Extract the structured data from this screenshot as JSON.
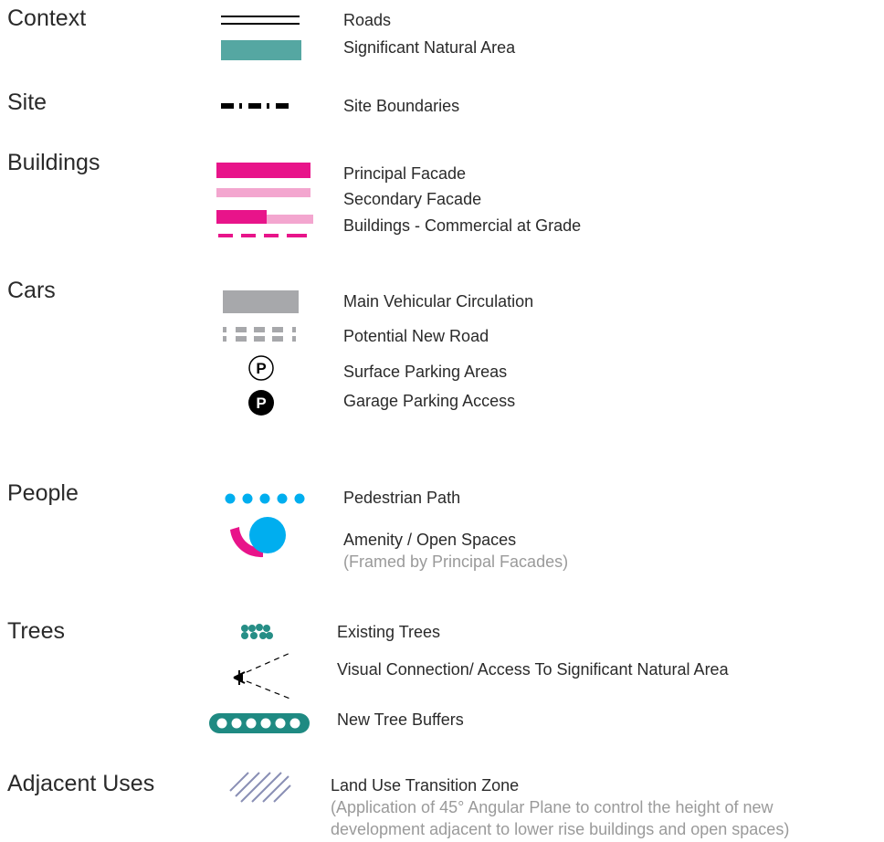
{
  "colors": {
    "teal": "#55a7a2",
    "magenta": "#e8148a",
    "pink_light": "#f3a6cf",
    "gray": "#a7a8ab",
    "cyan": "#00aeef",
    "hatch": "#8a8fb5",
    "black": "#000000"
  },
  "sections": {
    "context": {
      "title": "Context",
      "items": [
        {
          "label": "Roads",
          "icon": "double-line-icon"
        },
        {
          "label": "Significant Natural Area",
          "icon": "teal-block-icon"
        }
      ]
    },
    "site": {
      "title": "Site",
      "items": [
        {
          "label": "Site Boundaries",
          "icon": "dash-dot-line-icon"
        }
      ]
    },
    "buildings": {
      "title": "Buildings",
      "items": [
        {
          "label": "Principal Facade",
          "icon": "magenta-bar-icon"
        },
        {
          "label": "Secondary Facade",
          "icon": "pink-bar-icon"
        },
        {
          "label": "Buildings - Commercial at Grade",
          "icon": "commercial-bar-icon"
        }
      ]
    },
    "cars": {
      "title": "Cars",
      "items": [
        {
          "label": "Main Vehicular Circulation",
          "icon": "gray-block-icon"
        },
        {
          "label": "Potential New Road",
          "icon": "gray-dashed-road-icon"
        },
        {
          "label": "Surface Parking Areas",
          "icon": "parking-outline-icon",
          "glyph": "P"
        },
        {
          "label": "Garage Parking Access",
          "icon": "parking-filled-icon",
          "glyph": "P"
        }
      ]
    },
    "people": {
      "title": "People",
      "items": [
        {
          "label": "Pedestrian Path",
          "icon": "dotted-path-icon"
        },
        {
          "label": "Amenity / Open Spaces",
          "note": "(Framed by Principal Facades)",
          "icon": "amenity-icon"
        }
      ]
    },
    "trees": {
      "title": "Trees",
      "items": [
        {
          "label": "Existing Trees",
          "icon": "tree-cluster-icon"
        },
        {
          "label": "Visual Connection/ Access To Significant Natural Area",
          "icon": "view-cone-icon"
        },
        {
          "label": "New Tree Buffers",
          "icon": "tree-buffer-icon"
        }
      ]
    },
    "adjacent": {
      "title": "Adjacent Uses",
      "items": [
        {
          "label": "Land Use Transition Zone",
          "note_line1": "(Application of 45° Angular Plane to control the height of new",
          "note_line2": "development adjacent to lower rise buildings and open spaces)",
          "icon": "hatch-icon"
        }
      ]
    }
  }
}
